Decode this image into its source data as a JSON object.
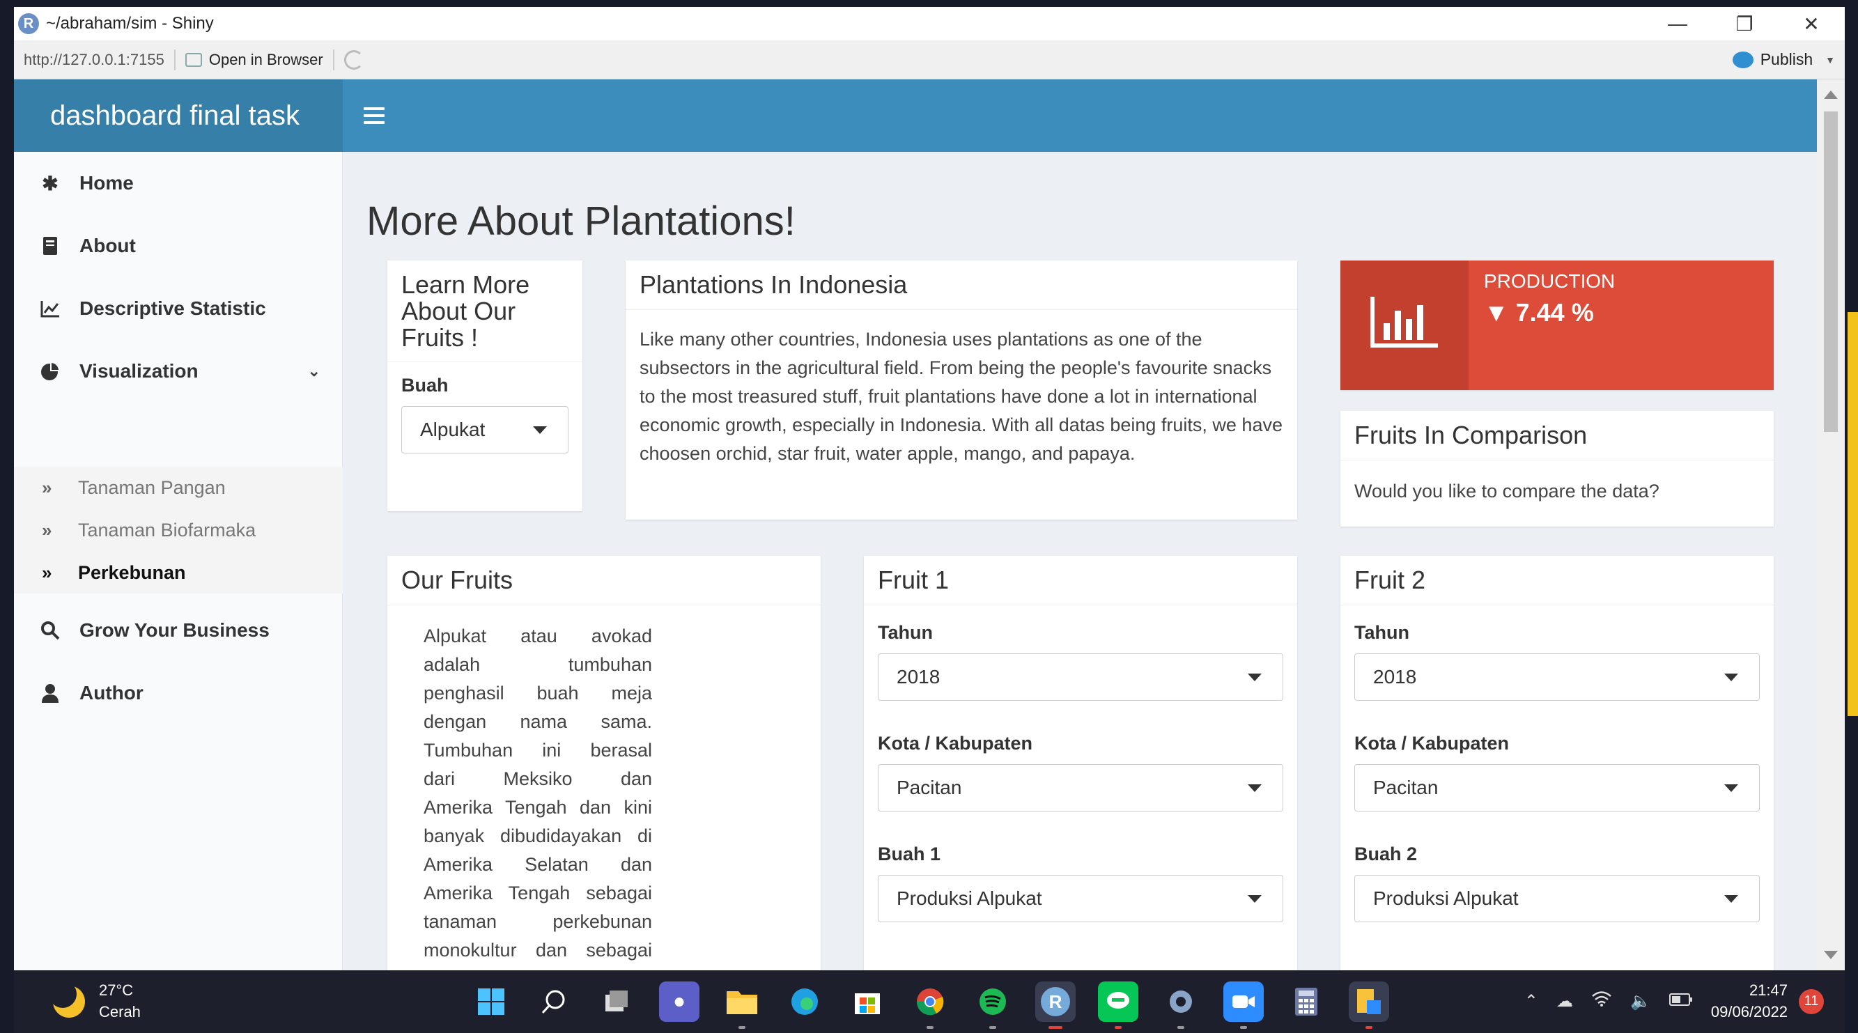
{
  "window": {
    "title": "~/abraham/sim - Shiny",
    "app_icon_letter": "R",
    "url": "http://127.0.0.1:7155",
    "open_in_browser": "Open in Browser",
    "publish": "Publish"
  },
  "header": {
    "brand": "dashboard final task"
  },
  "sidebar": {
    "items": [
      {
        "label": "Home",
        "icon": "asterisk-icon"
      },
      {
        "label": "About",
        "icon": "book-icon"
      },
      {
        "label": "Descriptive Statistic",
        "icon": "line-chart-icon"
      },
      {
        "label": "Visualization",
        "icon": "pie-chart-icon"
      },
      {
        "label": "Grow Your Business",
        "icon": "search-icon"
      },
      {
        "label": "Author",
        "icon": "user-icon"
      }
    ],
    "subitems": [
      {
        "label": "Tanaman Pangan"
      },
      {
        "label": "Tanaman Biofarmaka"
      },
      {
        "label": "Perkebunan"
      }
    ]
  },
  "main": {
    "page_title": "More About Plantations!",
    "learn_box": {
      "title": "Learn More About Our Fruits !",
      "label": "Buah",
      "value": "Alpukat"
    },
    "plantations_box": {
      "title": "Plantations In Indonesia",
      "body": "Like many other countries, Indonesia uses plantations as one of the subsectors in the agricultural field. From being the people's favourite snacks to the most treasured stuff, fruit plantations have done a lot in international economic growth, especially in Indonesia. With all datas being fruits, we have choosen orchid, star fruit, water apple, mango, and papaya."
    },
    "production_box": {
      "label": "PRODUCTION",
      "value": "▼ 7.44 %",
      "color": "#dd4b39"
    },
    "comparison_box": {
      "title": "Fruits In Comparison",
      "body": "Would you like to compare the data?"
    },
    "our_fruits_box": {
      "title": "Our Fruits",
      "lines": [
        "Alpukat atau avokad",
        "adalah tumbuhan",
        "penghasil buah meja",
        "dengan nama sama.",
        "Tumbuhan ini berasal",
        "dari Meksiko dan",
        "Amerika Tengah dan kini",
        "banyak dibudidayakan di",
        "Amerika Selatan dan",
        "Amerika Tengah sebagai",
        "tanaman perkebunan",
        "monokultur dan sebagai"
      ]
    },
    "fruit1_box": {
      "title": "Fruit 1",
      "tahun_label": "Tahun",
      "tahun_value": "2018",
      "kota_label": "Kota / Kabupaten",
      "kota_value": "Pacitan",
      "buah_label": "Buah 1",
      "buah_value": "Produksi Alpukat"
    },
    "fruit2_box": {
      "title": "Fruit 2",
      "tahun_label": "Tahun",
      "tahun_value": "2018",
      "kota_label": "Kota / Kabupaten",
      "kota_value": "Pacitan",
      "buah_label": "Buah 2",
      "buah_value": "Produksi Alpukat"
    }
  },
  "taskbar": {
    "temperature": "27°C",
    "weather": "Cerah",
    "time": "21:47",
    "date": "09/06/2022",
    "notifications": "11",
    "r_icon_letter": "R"
  }
}
